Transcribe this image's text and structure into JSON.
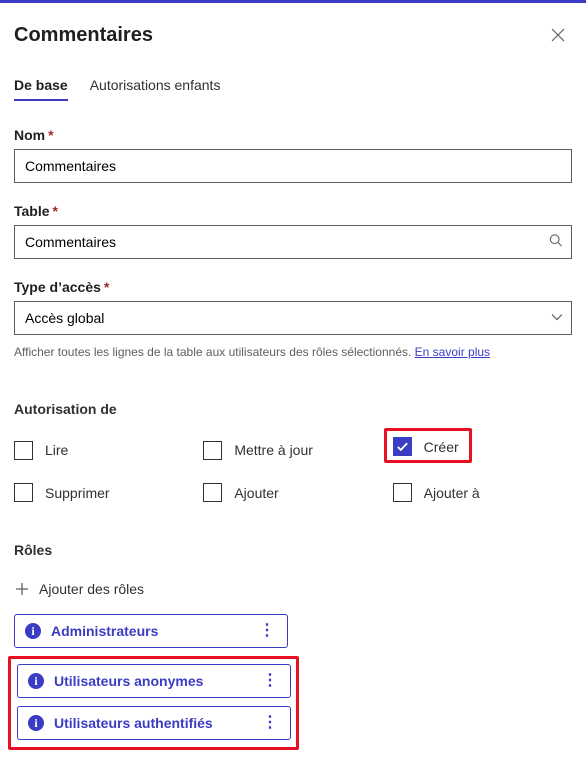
{
  "header": {
    "title": "Commentaires"
  },
  "tabs": [
    {
      "label": "De base",
      "active": true
    },
    {
      "label": "Autorisations enfants",
      "active": false
    }
  ],
  "fields": {
    "name": {
      "label": "Nom",
      "required": "*",
      "value": "Commentaires"
    },
    "table": {
      "label": "Table",
      "required": "*",
      "value": "Commentaires"
    },
    "access": {
      "label": "Type d’accès",
      "required": "*",
      "value": "Accès global"
    }
  },
  "helper": {
    "text": "Afficher toutes les lignes de la table aux utilisateurs des rôles sélectionnés. ",
    "link": "En savoir plus"
  },
  "perm_section_label": "Autorisation de",
  "permissions": [
    {
      "label": "Lire",
      "checked": false
    },
    {
      "label": "Mettre à jour",
      "checked": false
    },
    {
      "label": "Créer",
      "checked": true,
      "highlight": true
    },
    {
      "label": "Supprimer",
      "checked": false
    },
    {
      "label": "Ajouter",
      "checked": false
    },
    {
      "label": "Ajouter à",
      "checked": false
    }
  ],
  "roles_section": {
    "label": "Rôles",
    "add_label": "Ajouter des rôles",
    "items": [
      {
        "name": "Administrateurs",
        "highlight": false
      },
      {
        "name": "Utilisateurs anonymes",
        "highlight": true
      },
      {
        "name": "Utilisateurs authentifiés",
        "highlight": true
      }
    ]
  }
}
